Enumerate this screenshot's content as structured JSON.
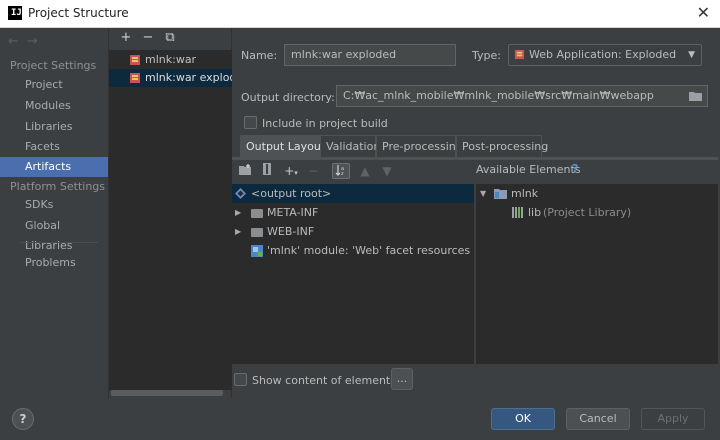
{
  "window": {
    "title": "Project Structure",
    "close_glyph": "✕",
    "logo_text": "IJ"
  },
  "nav": {
    "back_glyph": "←",
    "forward_glyph": "→"
  },
  "sidebar": {
    "project_settings_header": "Project Settings",
    "project_settings": [
      "Project",
      "Modules",
      "Libraries",
      "Facets",
      "Artifacts"
    ],
    "selected_item": "Artifacts",
    "platform_settings_header": "Platform Settings",
    "platform_settings": [
      "SDKs",
      "Global Libraries"
    ],
    "problems": "Problems"
  },
  "artifacts": {
    "toolbar": {
      "add": "+",
      "remove": "−",
      "copy": "⧉"
    },
    "items": [
      {
        "label": "mlnk:war",
        "selected": false
      },
      {
        "label": "mlnk:war exploded",
        "selected": true
      }
    ]
  },
  "form": {
    "name_label": "Name:",
    "name_value": "mlnk:war exploded",
    "type_label": "Type:",
    "type_value": "Web Application: Exploded",
    "output_dir_label": "Output directory:",
    "output_dir_value": "C:₩ac_mlnk_mobile₩mlnk_mobile₩src₩main₩webapp",
    "include_build_label": "Include in project build",
    "include_build_checked": false
  },
  "tabs": [
    {
      "label": "Output Layout",
      "active": true
    },
    {
      "label": "Validation",
      "active": false
    },
    {
      "label": "Pre-processing",
      "active": false
    },
    {
      "label": "Post-processing",
      "active": false
    }
  ],
  "layout": {
    "tree": [
      {
        "label": "<output root>",
        "kind": "root",
        "selected": true
      },
      {
        "label": "META-INF",
        "kind": "folder",
        "selected": false
      },
      {
        "label": "WEB-INF",
        "kind": "folder",
        "selected": false
      },
      {
        "label": "'mlnk' module: 'Web' facet resources",
        "kind": "facet",
        "selected": false
      }
    ],
    "available_header": "Available Elements",
    "available_help": "?",
    "available": [
      {
        "label": "mlnk",
        "kind": "module"
      },
      {
        "label": "lib",
        "suffix": "(Project Library)",
        "kind": "library"
      }
    ],
    "show_content_label": "Show content of elements",
    "show_content_checked": false,
    "ellipsis_button": "..."
  },
  "footer": {
    "help": "?",
    "ok": "OK",
    "cancel": "Cancel",
    "apply": "Apply"
  },
  "colors": {
    "background": "#3c3f41",
    "selection": "#4b6eaf",
    "tree_selection": "#0d293e",
    "primary_button": "#365880"
  }
}
